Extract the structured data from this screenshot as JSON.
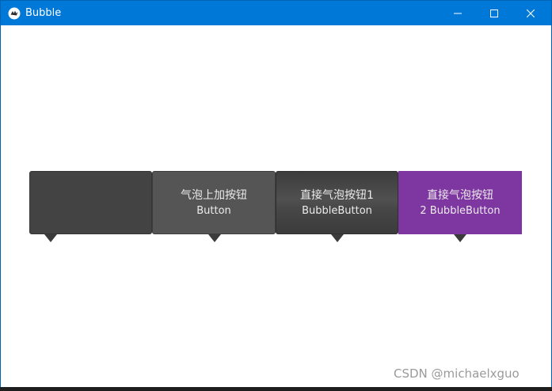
{
  "window": {
    "title": "Bubble"
  },
  "bubbles": [
    {
      "line1": "",
      "line2": ""
    },
    {
      "line1": "气泡上加按钮",
      "line2": "Button"
    },
    {
      "line1": "直接气泡按钮1",
      "line2": "BubbleButton"
    },
    {
      "line1": "直接气泡按钮",
      "line2": "2 BubbleButton"
    }
  ],
  "watermark": "CSDN @michaelxguo",
  "colors": {
    "titlebar": "#0078d7",
    "accent_purple": "#7e36a0",
    "bubble_dark": "#434343",
    "bubble_mid": "#555555"
  }
}
